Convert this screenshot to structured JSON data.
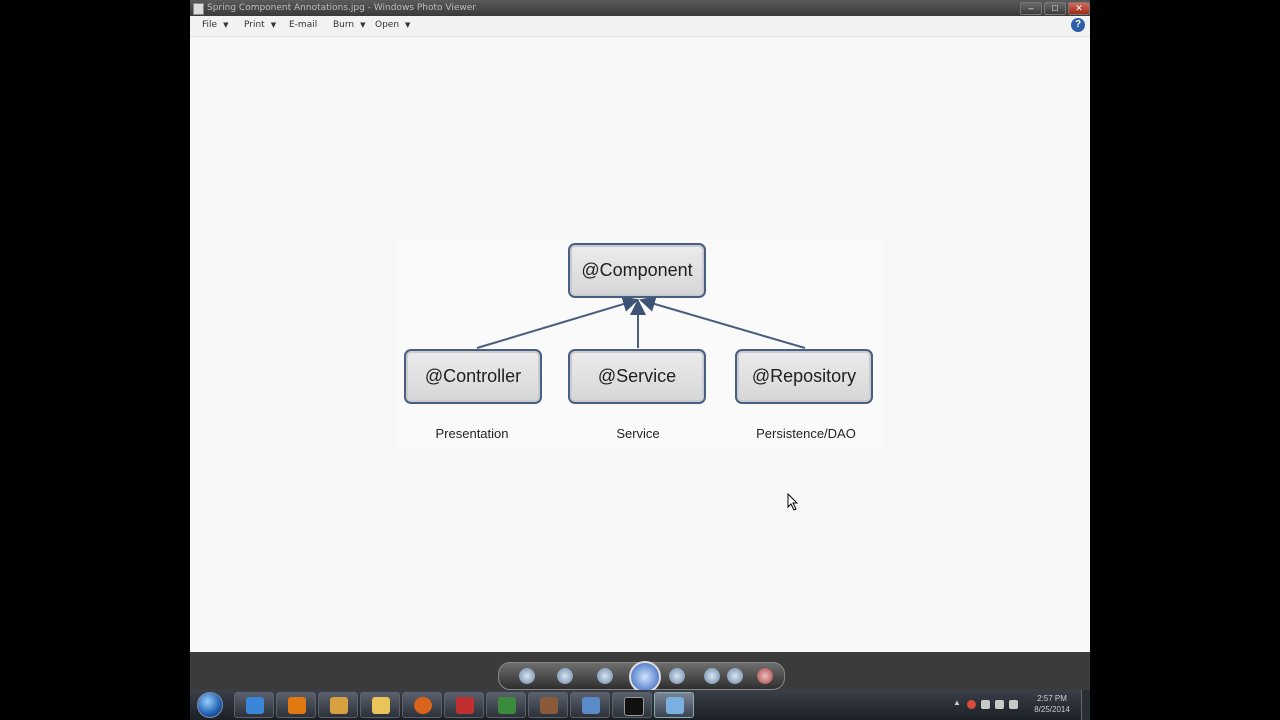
{
  "window": {
    "title": "Spring Component Annotations.jpg - Windows Photo Viewer",
    "buttons": {
      "minimize": "–",
      "maximize": "□",
      "close": "✕"
    }
  },
  "menubar": {
    "items": [
      {
        "label": "File"
      },
      {
        "label": "Print"
      },
      {
        "label": "E-mail"
      },
      {
        "label": "Burn"
      },
      {
        "label": "Open"
      }
    ],
    "help_label": "?"
  },
  "diagram": {
    "root": "@Component",
    "children": [
      "@Controller",
      "@Service",
      "@Repository"
    ],
    "layers": [
      "Presentation",
      "Service",
      "Persistence/DAO"
    ]
  },
  "taskbar": {
    "clock_time": "2:57 PM",
    "clock_date": "8/25/2014"
  }
}
